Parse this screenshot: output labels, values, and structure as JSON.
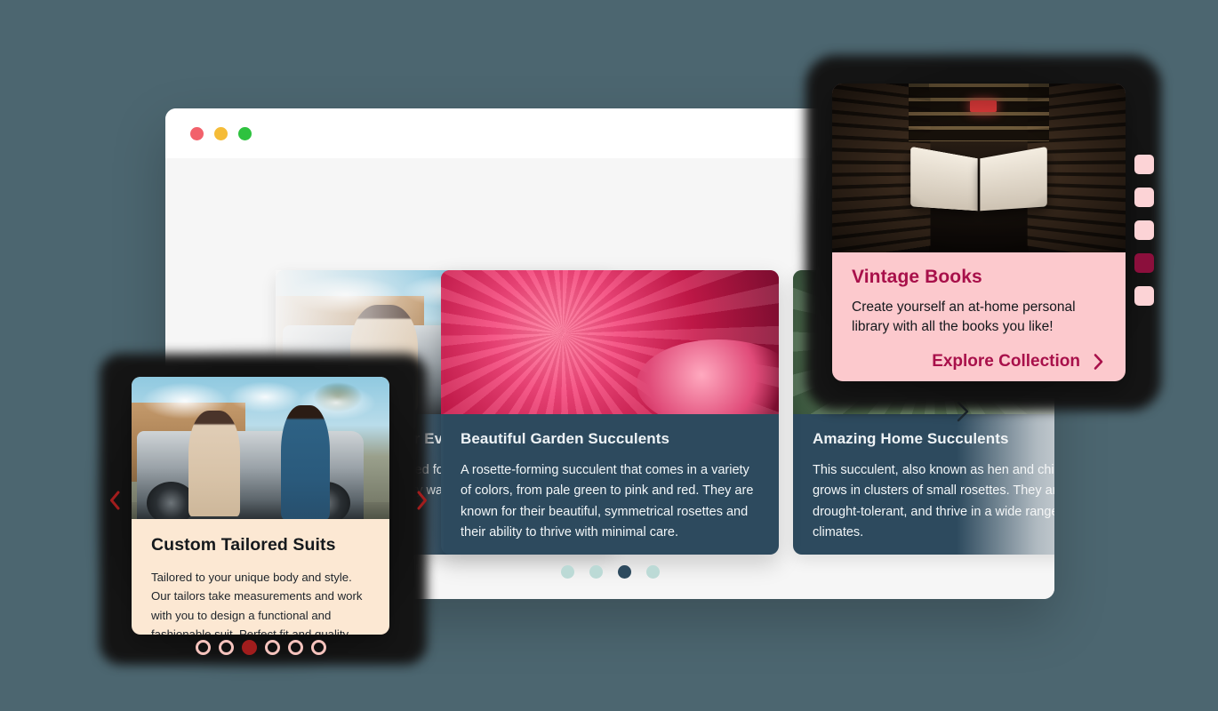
{
  "page": {
    "background_color": "#4c6670"
  },
  "browser_window": {
    "traffic_lights": [
      {
        "name": "close",
        "color": "#f2616b"
      },
      {
        "name": "minimize",
        "color": "#f5bc38"
      },
      {
        "name": "maximize",
        "color": "#2ec23f"
      }
    ]
  },
  "carousel": {
    "prev_label": "Previous slide",
    "next_label": "Next slide",
    "slides": [
      {
        "title": "Tailored Suits for Every Occasion",
        "description": "Bespoke suiting crafted for you, with fabrics and finishes that suit every wardrobe.",
        "image": "suits-photo"
      },
      {
        "title": "Beautiful Garden Succulents",
        "description": "A rosette-forming succulent that comes in a variety of colors, from pale green to pink and red. They are known for their beautiful, symmetrical rosettes and their ability to thrive with minimal care.",
        "image": "pink-dahlia-photo"
      },
      {
        "title": "Amazing Home Succulents",
        "description": "This succulent, also known as hen and chicks, grows in clusters of small rosettes. They are hardy, drought-tolerant, and thrive in a wide range of climates.",
        "image": "succulent-photo"
      }
    ],
    "pagination": {
      "count": 4,
      "active_index": 2,
      "dot_color": "#bcdad6",
      "active_dot_color": "#2d4a5e"
    },
    "card_background": "#2d4a5e"
  },
  "tablet_card": {
    "title": "Vintage Books",
    "description": "Create yourself an at-home personal library with all the books you like!",
    "cta_label": "Explore Collection",
    "image": "bookstore-photo",
    "background_color": "#fcc9cd",
    "accent_color": "#a8104a",
    "pagination": {
      "count": 5,
      "active_index": 3,
      "dot_color": "#fcd3d6",
      "active_dot_color": "#8b0f3c"
    }
  },
  "suits_card": {
    "title": "Custom Tailored Suits",
    "description": "Tailored to your unique body and style. Our tailors take measurements and work with you to design a functional and fashionable suit. Perfect fit and quality guaranteed.",
    "image": "suits-photo",
    "background_color": "#fce8d3",
    "prev_label": "Previous slide",
    "next_label": "Next slide",
    "arrow_color": "#a11d1d",
    "pagination": {
      "count": 6,
      "active_index": 2,
      "dot_color": "#f6c3bd",
      "active_dot_color": "#a11d1d"
    }
  }
}
